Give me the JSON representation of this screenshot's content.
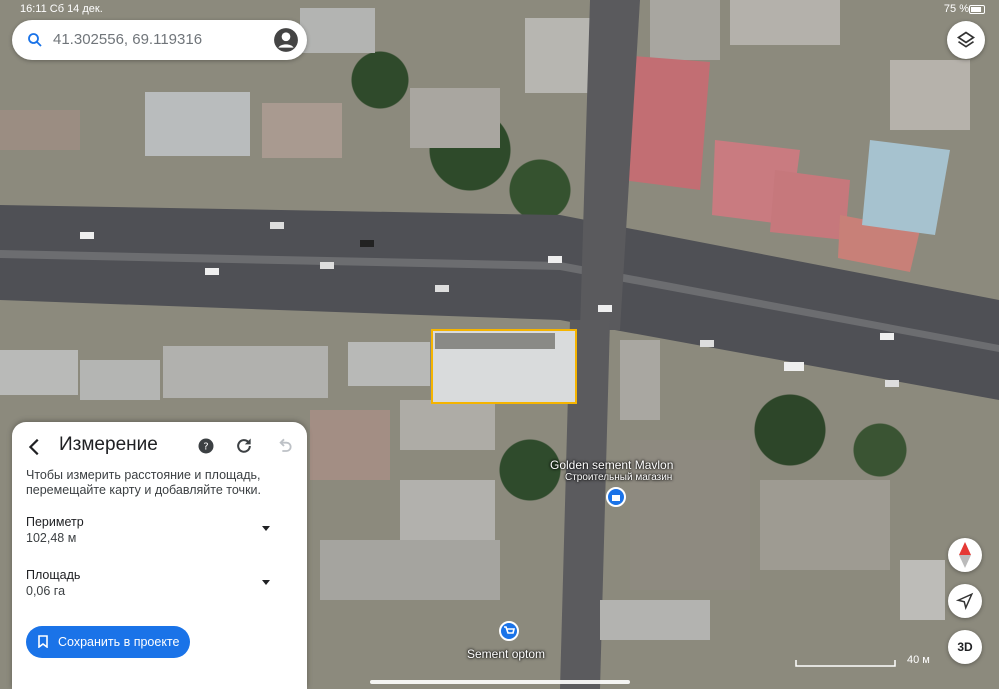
{
  "status_bar": {
    "time_date": "16:11  Сб 14 дек.",
    "battery": "75 %"
  },
  "search": {
    "query": "41.302556, 69.119316"
  },
  "panel": {
    "title": "Измерение",
    "description": "Чтобы измерить расстояние и площадь, перемещайте карту и добавляйте точки.",
    "perimeter_label": "Периметр",
    "perimeter_value": "102,48 м",
    "area_label": "Площадь",
    "area_value": "0,06 га",
    "save_label": "Сохранить в проекте"
  },
  "map": {
    "poi_1_name": "Golden sement Mavlon",
    "poi_1_type": "Строительный магазин",
    "poi_2_name": "Sement optom",
    "scale_label": "40 м"
  },
  "buttons": {
    "view_3d": "3D"
  },
  "colors": {
    "accent": "#1a73e8",
    "measure_outline": "#f5b400"
  }
}
